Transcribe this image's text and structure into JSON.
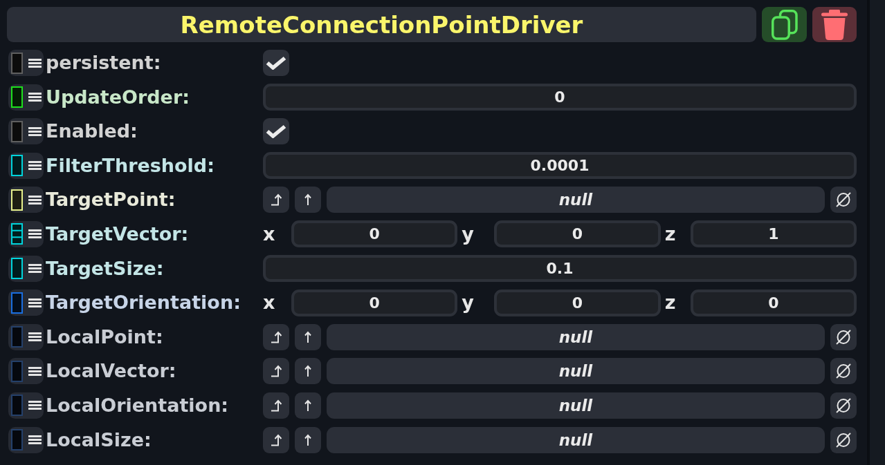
{
  "component": {
    "title": "RemoteConnectionPointDriver"
  },
  "fields": [
    {
      "label": "persistent:",
      "color": "#5f5f5f",
      "striped": false,
      "kind": "checkbox",
      "checked": true
    },
    {
      "label": "UpdateOrder:",
      "color": "#1ee01e",
      "striped": false,
      "kind": "number",
      "value": "0"
    },
    {
      "label": "Enabled:",
      "color": "#5f5f5f",
      "striped": false,
      "kind": "checkbox",
      "checked": true
    },
    {
      "label": "FilterThreshold:",
      "color": "#00d4dc",
      "striped": false,
      "kind": "number",
      "value": "0.0001"
    },
    {
      "label": "TargetPoint:",
      "color": "#e6f08c",
      "striped": false,
      "kind": "reference",
      "value": "null"
    },
    {
      "label": "TargetVector:",
      "color": "#00d4dc",
      "striped": true,
      "kind": "vector",
      "components": [
        {
          "axis": "x",
          "value": "0"
        },
        {
          "axis": "y",
          "value": "0"
        },
        {
          "axis": "z",
          "value": "1"
        }
      ]
    },
    {
      "label": "TargetSize:",
      "color": "#00d4dc",
      "striped": false,
      "kind": "number",
      "value": "0.1"
    },
    {
      "label": "TargetOrientation:",
      "color": "#1a6ee0",
      "striped": false,
      "kind": "vector",
      "components": [
        {
          "axis": "x",
          "value": "0"
        },
        {
          "axis": "y",
          "value": "0"
        },
        {
          "axis": "z",
          "value": "0"
        }
      ]
    },
    {
      "label": "LocalPoint:",
      "color": "#24406a",
      "striped": false,
      "kind": "reference",
      "value": "null"
    },
    {
      "label": "LocalVector:",
      "color": "#24406a",
      "striped": false,
      "kind": "reference",
      "value": "null"
    },
    {
      "label": "LocalOrientation:",
      "color": "#24406a",
      "striped": false,
      "kind": "reference",
      "value": "null"
    },
    {
      "label": "LocalSize:",
      "color": "#24406a",
      "striped": false,
      "kind": "reference",
      "value": "null"
    }
  ]
}
